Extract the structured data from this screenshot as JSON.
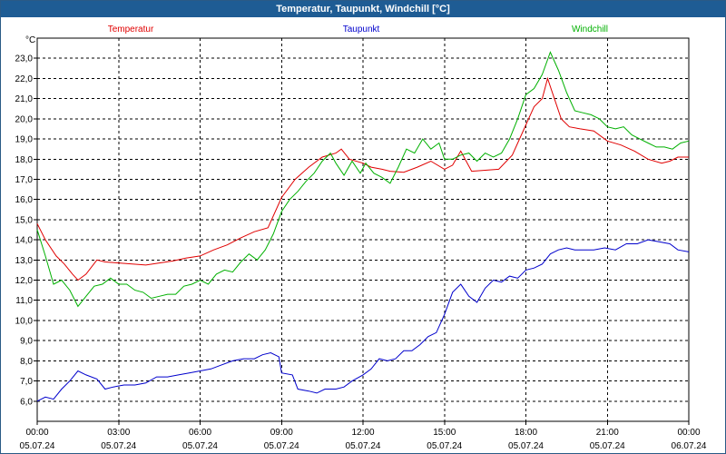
{
  "window": {
    "title": "Temperatur, Taupunkt, Windchill [°C]"
  },
  "chart_data": {
    "type": "line",
    "title": "Temperatur, Taupunkt, Windchill [°C]",
    "ylabel": "°C",
    "xlabel": "",
    "ylim": [
      5.0,
      24.0
    ],
    "y_ticks": [
      "6,0",
      "7,0",
      "8,0",
      "9,0",
      "10,0",
      "11,0",
      "12,0",
      "13,0",
      "14,0",
      "15,0",
      "16,0",
      "17,0",
      "18,0",
      "19,0",
      "20,0",
      "21,0",
      "22,0",
      "23,0"
    ],
    "x_range_hours": [
      0,
      24
    ],
    "x_ticks": [
      {
        "time": "00:00",
        "date": "05.07.24"
      },
      {
        "time": "03:00",
        "date": "05.07.24"
      },
      {
        "time": "06:00",
        "date": "05.07.24"
      },
      {
        "time": "09:00",
        "date": "05.07.24"
      },
      {
        "time": "12:00",
        "date": "05.07.24"
      },
      {
        "time": "15:00",
        "date": "05.07.24"
      },
      {
        "time": "18:00",
        "date": "05.07.24"
      },
      {
        "time": "21:00",
        "date": "05.07.24"
      },
      {
        "time": "00:00",
        "date": "06.07.24"
      }
    ],
    "grid": true,
    "legend_placement": "top",
    "series": [
      {
        "name": "Temperatur",
        "color": "#e00000",
        "points": [
          [
            0,
            14.8
          ],
          [
            0.3,
            14.0
          ],
          [
            0.7,
            13.2
          ],
          [
            1.0,
            12.8
          ],
          [
            1.3,
            12.3
          ],
          [
            1.5,
            12.0
          ],
          [
            1.8,
            12.3
          ],
          [
            2.2,
            13.0
          ],
          [
            2.5,
            12.9
          ],
          [
            3.0,
            12.85
          ],
          [
            3.5,
            12.8
          ],
          [
            4.0,
            12.75
          ],
          [
            4.5,
            12.85
          ],
          [
            5.0,
            12.95
          ],
          [
            5.5,
            13.1
          ],
          [
            6.0,
            13.2
          ],
          [
            6.5,
            13.5
          ],
          [
            7.0,
            13.75
          ],
          [
            7.5,
            14.1
          ],
          [
            8.0,
            14.4
          ],
          [
            8.5,
            14.6
          ],
          [
            9.0,
            16.1
          ],
          [
            9.5,
            17.0
          ],
          [
            10.0,
            17.6
          ],
          [
            10.5,
            18.1
          ],
          [
            11.0,
            18.3
          ],
          [
            11.2,
            18.5
          ],
          [
            11.5,
            18.0
          ],
          [
            12.0,
            17.8
          ],
          [
            12.3,
            17.6
          ],
          [
            12.7,
            17.5
          ],
          [
            13.0,
            17.4
          ],
          [
            13.5,
            17.35
          ],
          [
            14.0,
            17.6
          ],
          [
            14.5,
            17.9
          ],
          [
            15.0,
            17.5
          ],
          [
            15.3,
            17.7
          ],
          [
            15.6,
            18.4
          ],
          [
            16.0,
            17.4
          ],
          [
            16.5,
            17.45
          ],
          [
            17.0,
            17.5
          ],
          [
            17.5,
            18.2
          ],
          [
            18.0,
            19.7
          ],
          [
            18.3,
            20.6
          ],
          [
            18.6,
            21.0
          ],
          [
            18.8,
            22.0
          ],
          [
            19.0,
            21.2
          ],
          [
            19.3,
            20.0
          ],
          [
            19.6,
            19.6
          ],
          [
            20.0,
            19.5
          ],
          [
            20.5,
            19.4
          ],
          [
            21.0,
            18.9
          ],
          [
            21.5,
            18.7
          ],
          [
            22.0,
            18.4
          ],
          [
            22.5,
            18.0
          ],
          [
            23.0,
            17.8
          ],
          [
            23.3,
            17.9
          ],
          [
            23.6,
            18.1
          ],
          [
            24.0,
            18.1
          ]
        ]
      },
      {
        "name": "Taupunkt",
        "color": "#0000cc",
        "points": [
          [
            0,
            6.0
          ],
          [
            0.3,
            6.2
          ],
          [
            0.6,
            6.1
          ],
          [
            0.9,
            6.6
          ],
          [
            1.2,
            7.0
          ],
          [
            1.5,
            7.5
          ],
          [
            1.8,
            7.3
          ],
          [
            2.2,
            7.1
          ],
          [
            2.5,
            6.6
          ],
          [
            2.8,
            6.7
          ],
          [
            3.2,
            6.8
          ],
          [
            3.6,
            6.8
          ],
          [
            4.0,
            6.9
          ],
          [
            4.4,
            7.2
          ],
          [
            4.8,
            7.2
          ],
          [
            5.2,
            7.3
          ],
          [
            5.6,
            7.4
          ],
          [
            6.0,
            7.5
          ],
          [
            6.4,
            7.6
          ],
          [
            6.8,
            7.8
          ],
          [
            7.2,
            8.0
          ],
          [
            7.6,
            8.1
          ],
          [
            8.0,
            8.1
          ],
          [
            8.3,
            8.3
          ],
          [
            8.6,
            8.4
          ],
          [
            8.9,
            8.2
          ],
          [
            9.0,
            7.4
          ],
          [
            9.4,
            7.3
          ],
          [
            9.6,
            6.6
          ],
          [
            10.0,
            6.5
          ],
          [
            10.3,
            6.4
          ],
          [
            10.6,
            6.6
          ],
          [
            11.0,
            6.6
          ],
          [
            11.3,
            6.7
          ],
          [
            11.6,
            7.0
          ],
          [
            12.0,
            7.3
          ],
          [
            12.3,
            7.6
          ],
          [
            12.6,
            8.1
          ],
          [
            12.9,
            8.0
          ],
          [
            13.2,
            8.1
          ],
          [
            13.5,
            8.5
          ],
          [
            13.8,
            8.5
          ],
          [
            14.1,
            8.8
          ],
          [
            14.4,
            9.2
          ],
          [
            14.7,
            9.4
          ],
          [
            15.0,
            10.3
          ],
          [
            15.3,
            11.4
          ],
          [
            15.6,
            11.8
          ],
          [
            15.9,
            11.2
          ],
          [
            16.2,
            10.9
          ],
          [
            16.5,
            11.6
          ],
          [
            16.8,
            12.0
          ],
          [
            17.1,
            11.9
          ],
          [
            17.4,
            12.2
          ],
          [
            17.7,
            12.1
          ],
          [
            18.0,
            12.5
          ],
          [
            18.3,
            12.6
          ],
          [
            18.6,
            12.8
          ],
          [
            18.9,
            13.3
          ],
          [
            19.2,
            13.5
          ],
          [
            19.5,
            13.6
          ],
          [
            19.8,
            13.5
          ],
          [
            20.1,
            13.5
          ],
          [
            20.5,
            13.5
          ],
          [
            20.9,
            13.6
          ],
          [
            21.3,
            13.5
          ],
          [
            21.7,
            13.8
          ],
          [
            22.1,
            13.8
          ],
          [
            22.5,
            14.0
          ],
          [
            22.9,
            13.9
          ],
          [
            23.3,
            13.8
          ],
          [
            23.6,
            13.5
          ],
          [
            24.0,
            13.4
          ]
        ]
      },
      {
        "name": "Windchill",
        "color": "#00b000",
        "points": [
          [
            0,
            14.5
          ],
          [
            0.3,
            13.2
          ],
          [
            0.6,
            11.8
          ],
          [
            0.9,
            12.0
          ],
          [
            1.2,
            11.5
          ],
          [
            1.5,
            10.7
          ],
          [
            1.8,
            11.2
          ],
          [
            2.1,
            11.7
          ],
          [
            2.4,
            11.8
          ],
          [
            2.7,
            12.1
          ],
          [
            3.0,
            11.8
          ],
          [
            3.3,
            11.8
          ],
          [
            3.6,
            11.5
          ],
          [
            3.9,
            11.4
          ],
          [
            4.2,
            11.1
          ],
          [
            4.5,
            11.2
          ],
          [
            4.8,
            11.3
          ],
          [
            5.1,
            11.3
          ],
          [
            5.4,
            11.7
          ],
          [
            5.7,
            11.8
          ],
          [
            6.0,
            12.0
          ],
          [
            6.3,
            11.8
          ],
          [
            6.6,
            12.3
          ],
          [
            6.9,
            12.5
          ],
          [
            7.2,
            12.4
          ],
          [
            7.5,
            12.9
          ],
          [
            7.8,
            13.3
          ],
          [
            8.1,
            13.0
          ],
          [
            8.4,
            13.5
          ],
          [
            8.7,
            14.3
          ],
          [
            9.0,
            15.4
          ],
          [
            9.3,
            16.0
          ],
          [
            9.6,
            16.4
          ],
          [
            9.9,
            16.9
          ],
          [
            10.2,
            17.3
          ],
          [
            10.5,
            17.9
          ],
          [
            10.8,
            18.3
          ],
          [
            11.0,
            17.8
          ],
          [
            11.3,
            17.2
          ],
          [
            11.6,
            17.9
          ],
          [
            11.9,
            17.3
          ],
          [
            12.1,
            17.8
          ],
          [
            12.4,
            17.3
          ],
          [
            12.7,
            17.1
          ],
          [
            13.0,
            16.8
          ],
          [
            13.3,
            17.6
          ],
          [
            13.6,
            18.5
          ],
          [
            13.9,
            18.3
          ],
          [
            14.2,
            19.0
          ],
          [
            14.5,
            18.5
          ],
          [
            14.8,
            18.8
          ],
          [
            15.0,
            18.0
          ],
          [
            15.3,
            18.0
          ],
          [
            15.6,
            18.2
          ],
          [
            15.9,
            18.3
          ],
          [
            16.2,
            17.9
          ],
          [
            16.5,
            18.3
          ],
          [
            16.8,
            18.1
          ],
          [
            17.1,
            18.3
          ],
          [
            17.4,
            19.0
          ],
          [
            17.7,
            20.0
          ],
          [
            18.0,
            21.2
          ],
          [
            18.3,
            21.5
          ],
          [
            18.6,
            22.2
          ],
          [
            18.9,
            23.3
          ],
          [
            19.2,
            22.4
          ],
          [
            19.5,
            21.3
          ],
          [
            19.8,
            20.4
          ],
          [
            20.1,
            20.3
          ],
          [
            20.4,
            20.2
          ],
          [
            20.7,
            20.0
          ],
          [
            21.0,
            19.6
          ],
          [
            21.3,
            19.5
          ],
          [
            21.6,
            19.6
          ],
          [
            21.9,
            19.2
          ],
          [
            22.2,
            19.0
          ],
          [
            22.5,
            18.8
          ],
          [
            22.8,
            18.6
          ],
          [
            23.1,
            18.6
          ],
          [
            23.4,
            18.5
          ],
          [
            23.7,
            18.8
          ],
          [
            24.0,
            18.9
          ]
        ]
      }
    ]
  }
}
